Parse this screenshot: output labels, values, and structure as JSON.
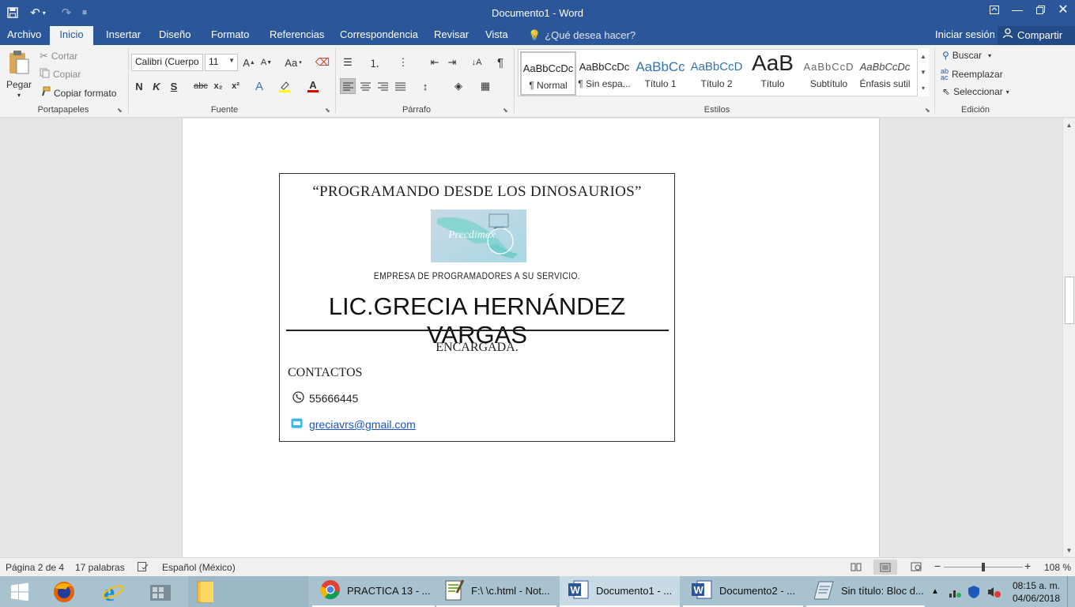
{
  "titlebar": {
    "title": "Documento1 - Word",
    "save_icon": "save-icon",
    "undo_icon": "undo-icon",
    "redo_icon": "redo-icon",
    "customize_icon": "customize-quick-access-icon"
  },
  "tabs": [
    "Archivo",
    "Inicio",
    "Insertar",
    "Diseño",
    "Formato",
    "Referencias",
    "Correspondencia",
    "Revisar",
    "Vista"
  ],
  "active_tab": "Inicio",
  "tell_me": "¿Qué desea hacer?",
  "signin": "Iniciar sesión",
  "share": "Compartir",
  "ribbon": {
    "clipboard": {
      "paste": "Pegar",
      "cut": "Cortar",
      "copy": "Copiar",
      "format_painter": "Copiar formato",
      "label": "Portapapeles"
    },
    "font": {
      "name": "Calibri (Cuerpo",
      "size": "11",
      "label": "Fuente",
      "bold": "N",
      "italic": "K",
      "underline": "S",
      "strike": "abc",
      "subscript": "x₂",
      "superscript": "x²",
      "change_case": "Aa"
    },
    "paragraph": {
      "label": "Párrafo"
    },
    "styles": {
      "label": "Estilos",
      "items": [
        {
          "preview": "AaBbCcDc",
          "name": "¶ Normal"
        },
        {
          "preview": "AaBbCcDc",
          "name": "¶ Sin espa..."
        },
        {
          "preview": "AaBbCc",
          "name": "Título 1"
        },
        {
          "preview": "AaBbCcD",
          "name": "Título 2"
        },
        {
          "preview": "AaB",
          "name": "Título"
        },
        {
          "preview": "AaBbCcD",
          "name": "Subtítulo"
        },
        {
          "preview": "AaBbCcDc",
          "name": "Énfasis sutil"
        }
      ]
    },
    "editing": {
      "find": "Buscar",
      "replace": "Reemplazar",
      "select": "Seleccionar",
      "label": "Edición"
    }
  },
  "document": {
    "slogan": "“PROGRAMANDO DESDE LOS DINOSAURIOS”",
    "logo_text": "Precdimex",
    "company": "EMPRESA DE PROGRAMADORES A SU SERVICIO.",
    "name": "LIC.GRECIA HERNÁNDEZ VARGAS",
    "role": "ENCARGADA.",
    "contacts_label": "CONTACTOS",
    "phone": "55666445",
    "email": "greciavrs@gmail.com"
  },
  "statusbar": {
    "page": "Página 2 de 4",
    "words": "17 palabras",
    "language": "Español (México)",
    "zoom": "108 %"
  },
  "taskbar": {
    "apps": [
      {
        "label": "PRACTICA 13 - ...",
        "icon": "chrome-icon"
      },
      {
        "label": "F:\\ \\c.html - Not...",
        "icon": "notepadpp-icon"
      },
      {
        "label": "Documento1 - ...",
        "icon": "word-icon"
      },
      {
        "label": "Documento2 - ...",
        "icon": "word-icon"
      },
      {
        "label": "Sin título: Bloc d...",
        "icon": "notepad-icon"
      }
    ],
    "time": "08:15 a. m.",
    "date": "04/06/2018"
  },
  "colors": {
    "word_blue": "#2b579a",
    "link": "#1a55c4",
    "taskbar": "#a9c2cf"
  }
}
